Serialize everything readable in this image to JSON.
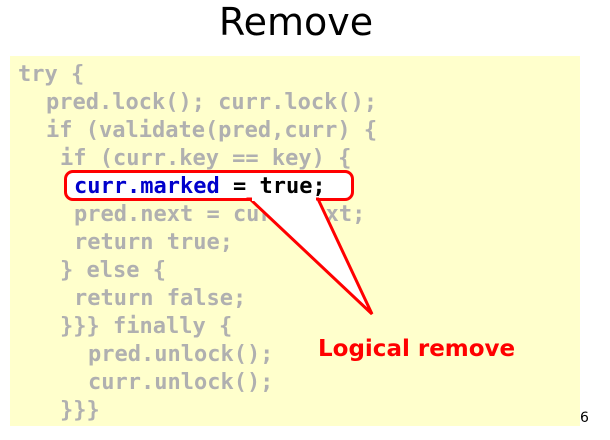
{
  "slide": {
    "title": "Remove",
    "page_number": "6"
  },
  "code": {
    "line1": "try {",
    "line2": "pred.lock(); curr.lock();",
    "line3": "if (validate(pred,curr) {",
    "line4": "if (curr.key == key) {",
    "line5_a": "curr.marked",
    "line5_b": " = ",
    "line5_c": "true;",
    "line6": "pred.next = curr.next;",
    "line7": "return true;",
    "line8": "} else {",
    "line9": "return false;",
    "line10": "}}} finally {",
    "line11": "pred.unlock();",
    "line12": "curr.unlock();",
    "line13": "}}}"
  },
  "callout": {
    "label": "Logical remove",
    "color": "#ff0000"
  },
  "colors": {
    "code_background": "#ffffcc",
    "code_text_dim": "#b0b0b0",
    "keyword_blue": "#0000cc"
  }
}
